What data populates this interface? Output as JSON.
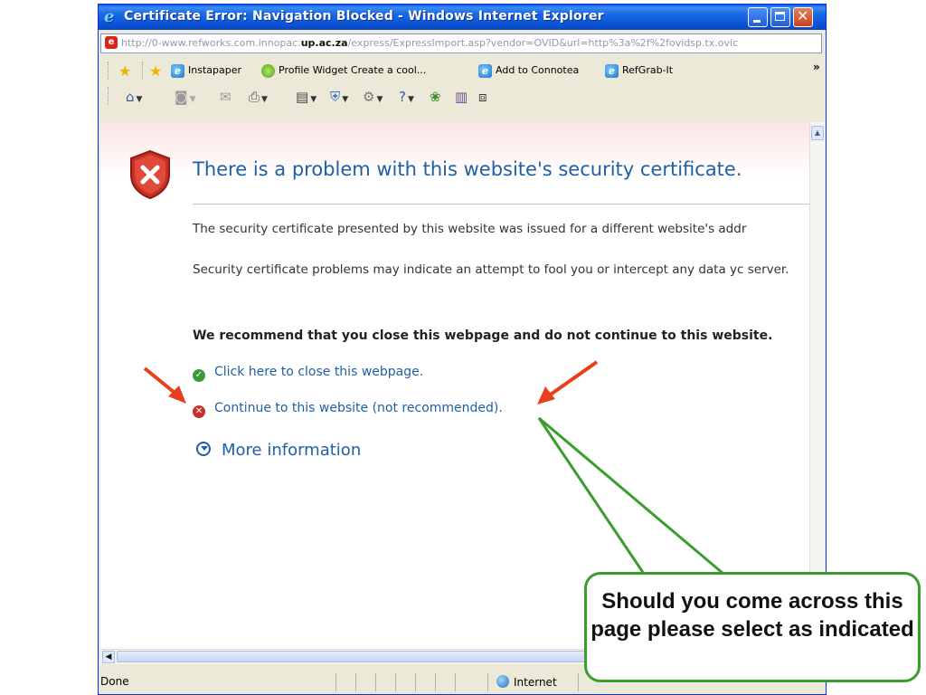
{
  "window": {
    "title": "Certificate Error: Navigation Blocked - Windows Internet Explorer"
  },
  "address": {
    "url_prefix": "http://0-www.refworks.com.innopac.",
    "url_host": "up.ac.za",
    "url_suffix": "/express/ExpressImport.asp?vendor=OVID&url=http%3a%2f%2fovidsp.tx.ovic"
  },
  "links_toolbar": {
    "items": [
      {
        "label": "Instapaper",
        "icon": "ie-page-icon"
      },
      {
        "label": "Profile Widget Create a cool...",
        "icon": "green-widget-icon"
      },
      {
        "label": "Add to Connotea",
        "icon": "ie-page-icon"
      },
      {
        "label": "RefGrab-It",
        "icon": "ie-page-icon"
      }
    ],
    "more": "»"
  },
  "page": {
    "heading": "There is a problem with this website's security certificate.",
    "para1": "The security certificate presented by this website was issued for a different website's addr",
    "para2": "Security certificate problems may indicate an attempt to fool you or intercept any data yc server.",
    "recommend": "We recommend that you close this webpage and do not continue to this website.",
    "close_link": "Click here to close this webpage.",
    "continue_link": "Continue to this website (not recommended).",
    "more_info": "More information"
  },
  "status": {
    "text": "Done",
    "zone": "Internet"
  },
  "annotation": {
    "callout": "Should you come across this page please select as indicated",
    "arrow_color": "#E8401C",
    "callout_border_color": "#3A9E2E"
  }
}
